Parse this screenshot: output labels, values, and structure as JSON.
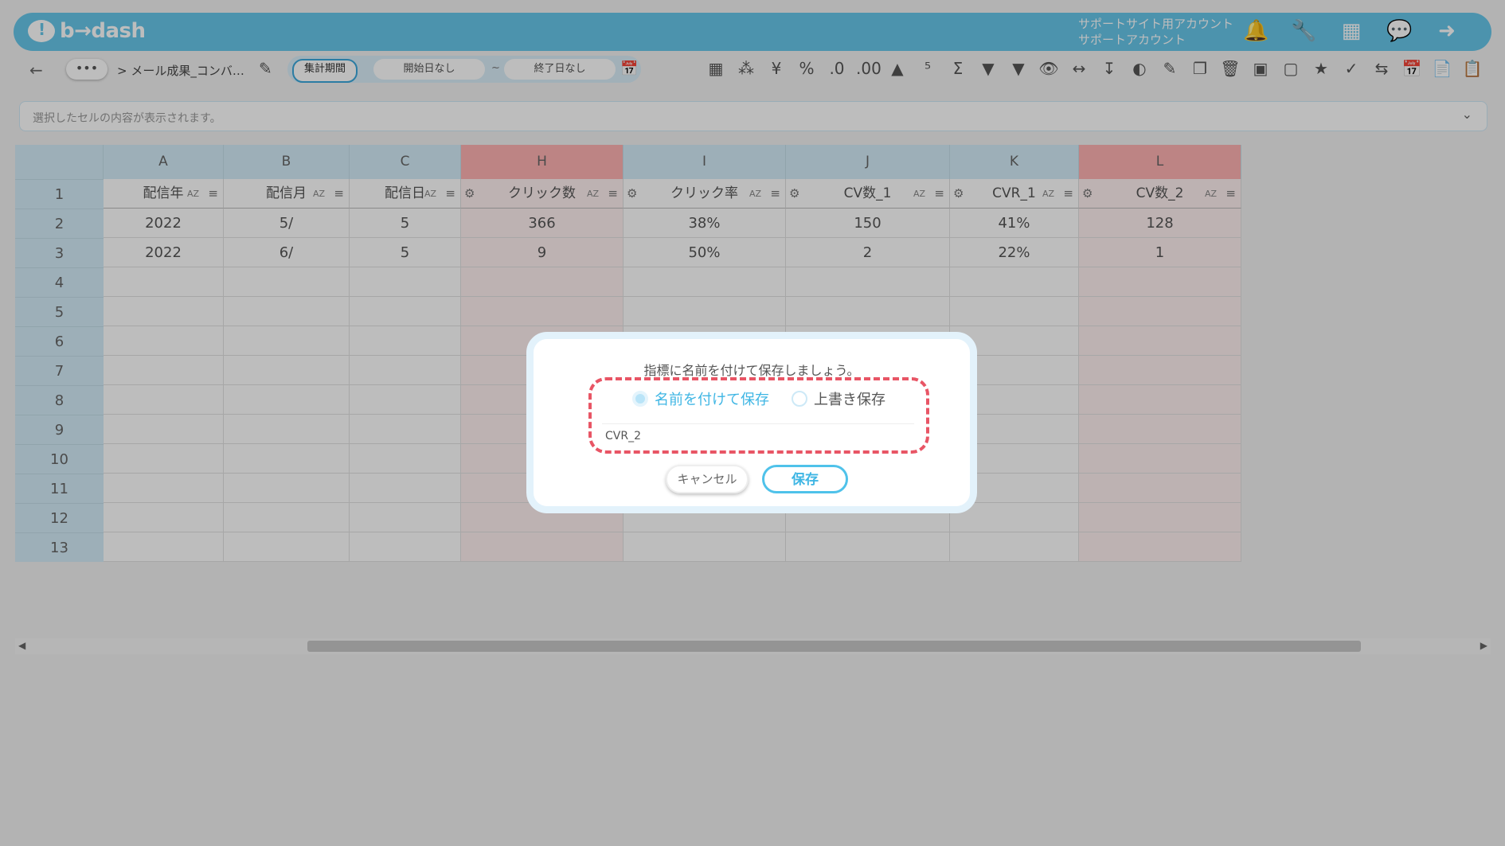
{
  "app": {
    "logo_text": "b→dash",
    "account_line1": "サポートサイト用アカウント",
    "account_line2": "サポートアカウント"
  },
  "topicons": [
    "bell-icon",
    "wrench-icon",
    "apps-grid-icon",
    "chat-icon",
    "logout-icon"
  ],
  "toolbar": {
    "back_label": "←",
    "more_label": "•••",
    "breadcrumb": "> メール成果_コンバ…",
    "period_label": "集計期間",
    "start_date": "開始日なし",
    "tilde": "~",
    "end_date": "終了日なし",
    "tool_icons": [
      "table-icon",
      "spinner-icon",
      "yen-icon",
      "percent-icon",
      "decimal-decrease-icon",
      "decimal-increase-icon",
      "times-ten-icon",
      "round-icon",
      "sum-icon",
      "filter-clear-icon",
      "filter-icon",
      "eye-icon",
      "code-icon",
      "download-icon",
      "chart-icon",
      "edit-icon",
      "copy-icon",
      "trash-icon",
      "archive-icon",
      "archive-disabled-icon",
      "star-icon",
      "user-check-icon",
      "repeat-icon",
      "calendar-icon",
      "document-icon",
      "clipboard-icon"
    ]
  },
  "cellbar": {
    "placeholder": "選択したセルの内容が表示されます。"
  },
  "grid": {
    "columns": [
      {
        "letter": "A",
        "name": "配信年",
        "highlight": false,
        "gear": false
      },
      {
        "letter": "B",
        "name": "配信月",
        "highlight": false,
        "gear": false
      },
      {
        "letter": "C",
        "name": "配信日",
        "highlight": false,
        "gear": false
      },
      {
        "letter": "H",
        "name": "クリック数",
        "highlight": true,
        "gear": true
      },
      {
        "letter": "I",
        "name": "クリック率",
        "highlight": false,
        "gear": true
      },
      {
        "letter": "J",
        "name": "CV数_1",
        "highlight": false,
        "gear": true
      },
      {
        "letter": "K",
        "name": "CVR_1",
        "highlight": false,
        "gear": true
      },
      {
        "letter": "L",
        "name": "CV数_2",
        "highlight": true,
        "gear": true
      }
    ],
    "sort_label": "AZ",
    "rows": [
      [
        "2022",
        "5/",
        "5",
        "366",
        "38%",
        "150",
        "41%",
        "128"
      ],
      [
        "2022",
        "6/",
        "5",
        "9",
        "50%",
        "2",
        "22%",
        "1"
      ],
      [
        "",
        "",
        "",
        "",
        "",
        "",
        "",
        ""
      ],
      [
        "",
        "",
        "",
        "",
        "",
        "",
        "",
        ""
      ],
      [
        "",
        "",
        "",
        "",
        "",
        "",
        "",
        ""
      ],
      [
        "",
        "",
        "",
        "",
        "",
        "",
        "",
        ""
      ],
      [
        "",
        "",
        "",
        "",
        "",
        "",
        "",
        ""
      ],
      [
        "",
        "",
        "",
        "",
        "",
        "",
        "",
        ""
      ],
      [
        "",
        "",
        "",
        "",
        "",
        "",
        "",
        ""
      ],
      [
        "",
        "",
        "",
        "",
        "",
        "",
        "",
        ""
      ],
      [
        "",
        "",
        "",
        "",
        "",
        "",
        "",
        ""
      ],
      [
        "",
        "",
        "",
        "",
        "",
        "",
        "",
        ""
      ]
    ],
    "row_numbers": [
      "1",
      "2",
      "3",
      "4",
      "5",
      "6",
      "7",
      "8",
      "9",
      "10",
      "11",
      "12",
      "13"
    ]
  },
  "modal": {
    "message": "指標に名前を付けて保存しましょう。",
    "option_save_as": "名前を付けて保存",
    "option_overwrite": "上書き保存",
    "selected_option": "名前を付けて保存",
    "name_value": "CVR_2",
    "cancel_label": "キャンセル",
    "save_label": "保存"
  },
  "colors": {
    "header_bg": "#67c7ea",
    "accent": "#3fb6e4",
    "highlight_column": "#ffb3b3",
    "dash_outline": "#e85565"
  }
}
